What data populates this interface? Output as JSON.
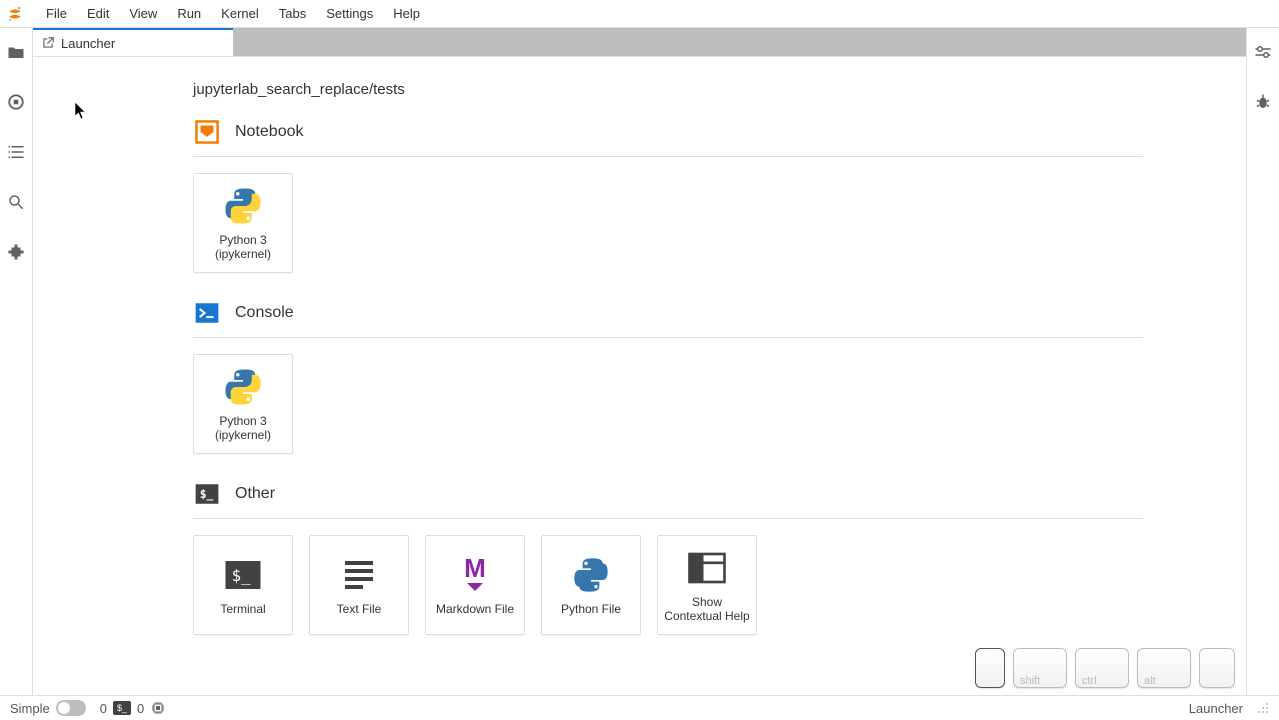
{
  "menu": {
    "file": "File",
    "edit": "Edit",
    "view": "View",
    "run": "Run",
    "kernel": "Kernel",
    "tabs": "Tabs",
    "settings": "Settings",
    "help": "Help"
  },
  "tab": {
    "launcher_label": "Launcher"
  },
  "breadcrumb": "jupyterlab_search_replace/tests",
  "sections": {
    "notebook": {
      "title": "Notebook",
      "cards": {
        "python3": "Python 3 (ipykernel)"
      }
    },
    "console": {
      "title": "Console",
      "cards": {
        "python3": "Python 3 (ipykernel)"
      }
    },
    "other": {
      "title": "Other",
      "cards": {
        "terminal": "Terminal",
        "text": "Text File",
        "markdown": "Markdown File",
        "python": "Python File",
        "help": "Show Contextual Help"
      }
    }
  },
  "status": {
    "simple": "Simple",
    "running_count": "0",
    "terminals_count": "0",
    "right": "Launcher"
  },
  "keys": {
    "blank1": "",
    "shift": "shift",
    "ctrl": "ctrl",
    "alt": "alt",
    "blank2": ""
  },
  "colors": {
    "accent_orange": "#f57c00",
    "accent_blue": "#1976d2",
    "terminal_bg": "#424242",
    "python_blue": "#3776ab",
    "python_yellow": "#ffd43b",
    "markdown_purple": "#8e24aa"
  }
}
